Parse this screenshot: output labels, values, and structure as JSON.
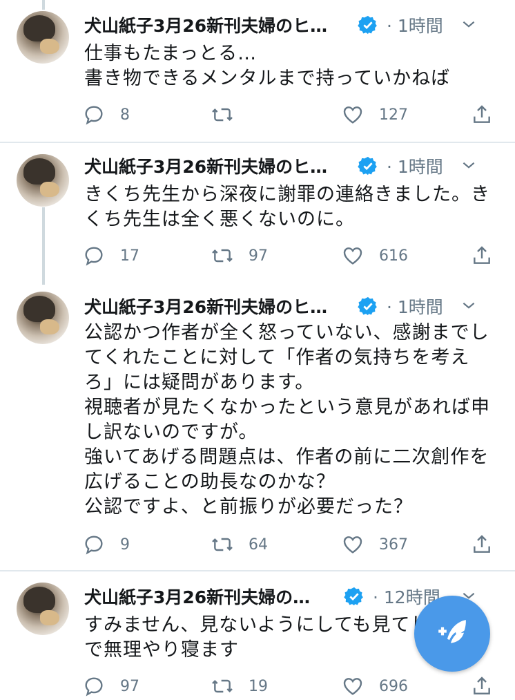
{
  "tweets": [
    {
      "author": "犬山紙子3月26新刊夫婦のヒ…",
      "time": "1時間",
      "text": "仕事もたまっとる…\n書き物できるメンタルまで持っていかねば",
      "replies": "8",
      "retweets": "",
      "likes": "127"
    },
    {
      "author": "犬山紙子3月26新刊夫婦のヒ…",
      "time": "1時間",
      "text": "きくち先生から深夜に謝罪の連絡きました。き\nくち先生は全く悪くないのに。",
      "replies": "17",
      "retweets": "97",
      "likes": "616"
    },
    {
      "author": "犬山紙子3月26新刊夫婦のヒ…",
      "time": "1時間",
      "text": "公認かつ作者が全く怒っていない、感謝までし\nてくれたことに対して「作者の気持ちを考え\nろ」には疑問があります。\n視聴者が見たくなかったという意見があれば申\nし訳ないのですが。\n強いてあげる問題点は、作者の前に二次創作を\n広げることの助長なのかな？\n公認ですよ、と前振りが必要だった？",
      "replies": "9",
      "retweets": "64",
      "likes": "367"
    },
    {
      "author": "犬山紙子3月26新刊夫婦の…",
      "time": "12時間",
      "text": "すみません、見ないようにしても見てし\nで無理やり寝ます",
      "replies": "97",
      "retweets": "19",
      "likes": "696"
    }
  ],
  "colors": {
    "accent": "#1da1f2",
    "fab": "#4a99e9",
    "muted": "#657786"
  },
  "icons": {
    "reply": "reply-icon",
    "retweet": "retweet-icon",
    "like": "heart-icon",
    "share": "share-icon",
    "compose": "compose-tweet-icon"
  }
}
